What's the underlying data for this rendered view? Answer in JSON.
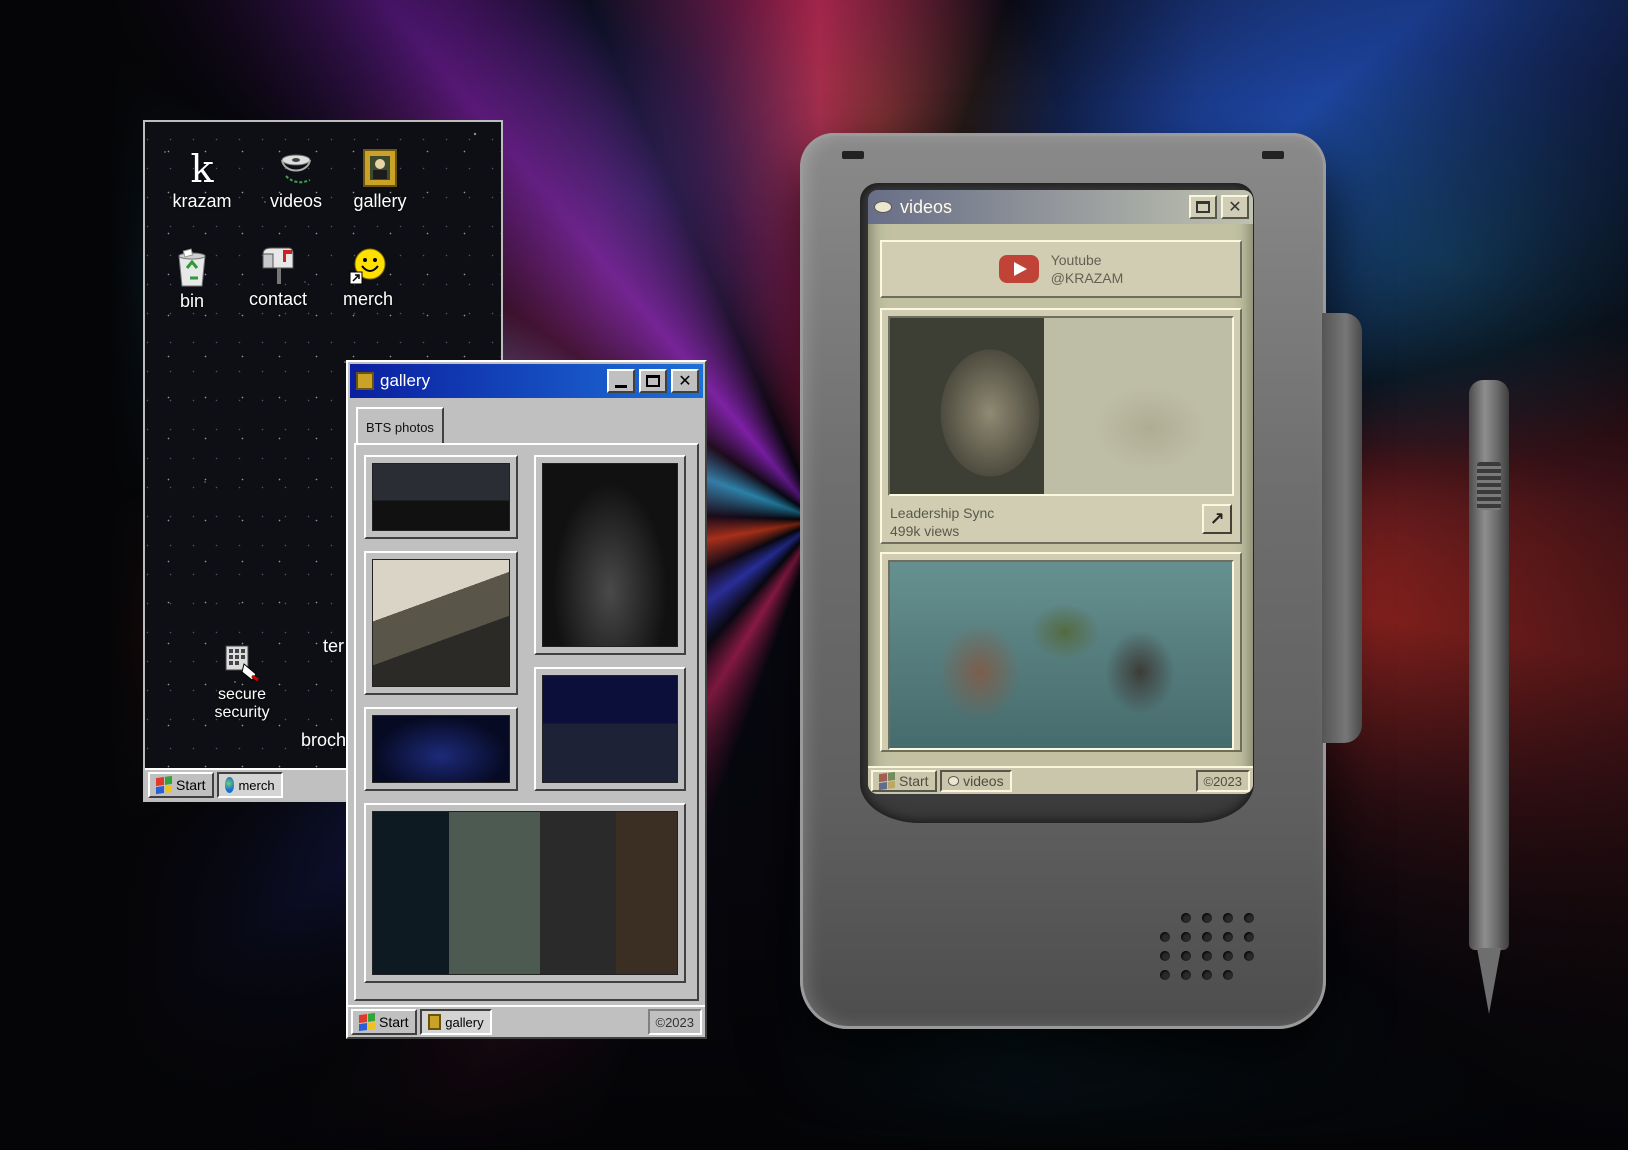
{
  "desktop": {
    "icons": [
      {
        "label": "krazam",
        "icon": "krazam-k-icon"
      },
      {
        "label": "videos",
        "icon": "film-reel-icon"
      },
      {
        "label": "gallery",
        "icon": "portrait-frame-icon"
      },
      {
        "label": "bin",
        "icon": "recycle-bin-icon"
      },
      {
        "label": "contact",
        "icon": "mailbox-icon"
      },
      {
        "label": "merch",
        "icon": "smiley-shortcut-icon"
      },
      {
        "label": "secure security",
        "icon": "keypad-hand-icon"
      }
    ],
    "partial_labels": [
      "ter",
      "broch"
    ],
    "taskbar": {
      "start_label": "Start",
      "active_task": "merch"
    }
  },
  "gallery": {
    "title": "gallery",
    "tab_label": "BTS photos",
    "taskbar": {
      "start_label": "Start",
      "active_task": "gallery",
      "clock": "©2023"
    }
  },
  "videos": {
    "title": "videos",
    "youtube": {
      "line1": "Youtube",
      "line2": "@KRAZAM"
    },
    "cards": [
      {
        "title": "Leadership Sync",
        "views": "499k views"
      },
      {
        "title": "",
        "views": ""
      }
    ],
    "taskbar": {
      "start_label": "Start",
      "active_task": "videos",
      "clock": "©2023"
    }
  },
  "colors": {
    "win_titlebar": "#0b1fa0",
    "win_face": "#c0c0c0",
    "device_screen": "#b8bda0",
    "youtube_red": "#cc3a30"
  }
}
